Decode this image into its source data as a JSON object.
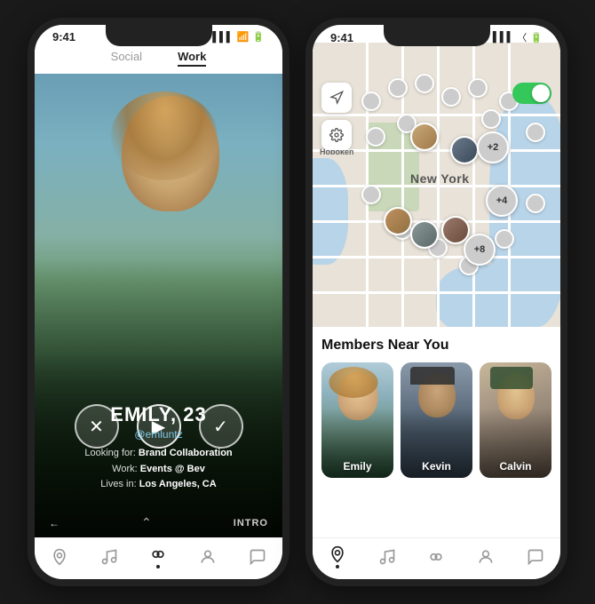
{
  "leftPhone": {
    "statusBar": {
      "time": "9:41",
      "signal": "▌▌▌",
      "wifi": "WiFi",
      "battery": "■"
    },
    "tabs": {
      "social": "Social",
      "work": "Work",
      "activeTab": "work"
    },
    "profile": {
      "name": "EMILY, 23",
      "handle": "@emluntz",
      "lookingFor": "Brand Collaboration",
      "work": "Events @ Bev",
      "lives": "Los Angeles, CA"
    },
    "actionButtons": {
      "close": "✕",
      "play": "▶",
      "check": "✓"
    },
    "bottomBar": {
      "back": "←",
      "intro": "INTRO"
    },
    "nav": {
      "items": [
        "location",
        "music",
        "connect",
        "profile",
        "chat"
      ],
      "active": "connect"
    }
  },
  "rightPhone": {
    "statusBar": {
      "time": "9:41"
    },
    "map": {
      "cityLabel": "New York",
      "toggleOn": true
    },
    "members": {
      "title": "Members Near You",
      "people": [
        {
          "name": "Emily",
          "colorClass": "member-emily"
        },
        {
          "name": "Kevin",
          "colorClass": "member-kevin"
        },
        {
          "name": "Calvin",
          "colorClass": "member-calvin"
        }
      ]
    },
    "nav": {
      "items": [
        "location",
        "music",
        "connect",
        "profile",
        "chat"
      ],
      "active": "location"
    }
  }
}
